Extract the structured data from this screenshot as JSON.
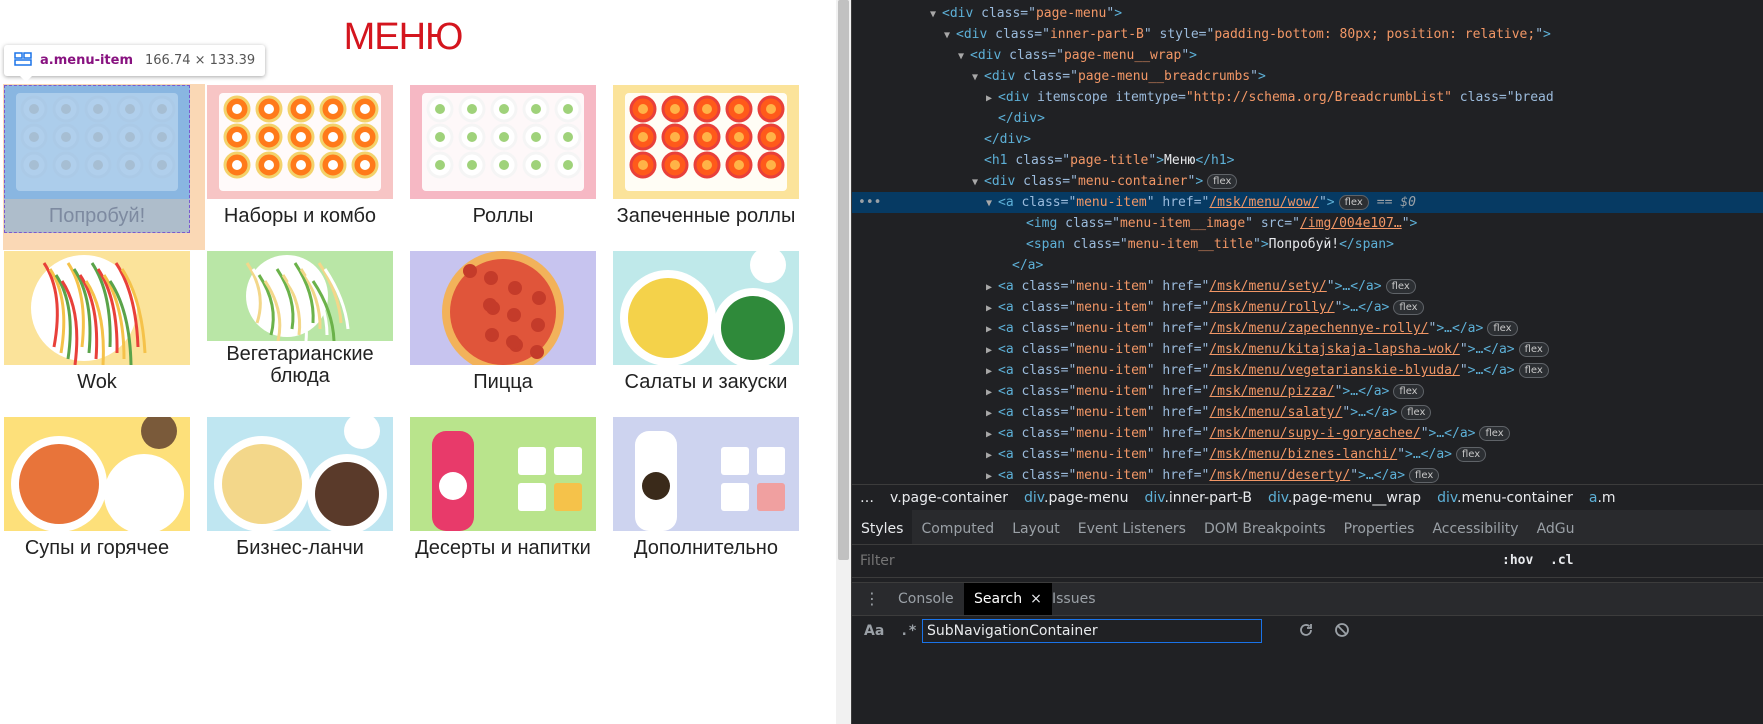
{
  "page": {
    "title": "МЕНЮ",
    "menu_items": [
      {
        "title": "Попробуй!",
        "bg": "#a9c8e6"
      },
      {
        "title": "Наборы и комбо",
        "bg": "#f7c5c5"
      },
      {
        "title": "Роллы",
        "bg": "#f6b8c4"
      },
      {
        "title": "Запеченные роллы",
        "bg": "#fbe39a"
      },
      {
        "title": "Wok",
        "bg": "#fbe39a"
      },
      {
        "title": "Вегетарианские блюда",
        "bg": "#b9e6a6"
      },
      {
        "title": "Пицца",
        "bg": "#c7c4ef"
      },
      {
        "title": "Салаты и закуски",
        "bg": "#bfe9ea"
      },
      {
        "title": "Супы и горячее",
        "bg": "#fde07a"
      },
      {
        "title": "Бизнес-ланчи",
        "bg": "#bfe6f1"
      },
      {
        "title": "Десерты и напитки",
        "bg": "#b9e48c"
      },
      {
        "title": "Дополнительно",
        "bg": "#cdd3ef"
      }
    ]
  },
  "tooltip": {
    "tag": "a.menu-item",
    "dims": "166.74 × 133.39"
  },
  "devtools": {
    "dom": [
      {
        "indent": 78,
        "tri": "▼",
        "open": "<div",
        "attrs": [
          [
            "class",
            "page-menu"
          ]
        ],
        "close": ">"
      },
      {
        "indent": 92,
        "tri": "▼",
        "open": "<div",
        "attrs": [
          [
            "class",
            "inner-part-B"
          ],
          [
            "style",
            "padding-bottom: 80px; position: relative;"
          ]
        ],
        "close": ">"
      },
      {
        "indent": 106,
        "tri": "▼",
        "open": "<div",
        "attrs": [
          [
            "class",
            "page-menu__wrap"
          ]
        ],
        "close": ">"
      },
      {
        "indent": 120,
        "tri": "▼",
        "open": "<div",
        "attrs": [
          [
            "class",
            "page-menu__breadcrumbs"
          ]
        ],
        "close": ">"
      },
      {
        "indent": 134,
        "tri": "▶",
        "open": "<div",
        "attrs_raw": " itemscope itemtype=",
        "raw_val": "\"http://schema.org/BreadcrumbList\"",
        "tail": " class=\"bread"
      },
      {
        "indent": 134,
        "tri": "",
        "plain": "</div>"
      },
      {
        "indent": 120,
        "tri": "",
        "plain": "</div>"
      },
      {
        "indent": 120,
        "tri": "",
        "open": "<h1",
        "attrs": [
          [
            "class",
            "page-title"
          ]
        ],
        "close": ">",
        "text": "Меню",
        "end": "</h1>"
      },
      {
        "indent": 120,
        "tri": "▼",
        "open": "<div",
        "attrs": [
          [
            "class",
            "menu-container"
          ]
        ],
        "close": ">",
        "badge": "flex"
      },
      {
        "indent": 134,
        "tri": "▼",
        "open": "<a",
        "attrs": [
          [
            "class",
            "menu-item"
          ]
        ],
        "href": "/msk/menu/wow/",
        "close": ">",
        "badge": "flex",
        "eq": "== $0",
        "selected": true
      },
      {
        "indent": 162,
        "tri": "",
        "open": "<img",
        "attrs": [
          [
            "class",
            "menu-item__image"
          ]
        ],
        "src": "/img/004e107…",
        "close": ">"
      },
      {
        "indent": 162,
        "tri": "",
        "open": "<span",
        "attrs": [
          [
            "class",
            "menu-item__title"
          ]
        ],
        "close": ">",
        "text": "Попробуй!",
        "end": "</span>"
      },
      {
        "indent": 148,
        "tri": "",
        "plain": "</a>"
      },
      {
        "indent": 134,
        "tri": "▶",
        "open": "<a",
        "attrs": [
          [
            "class",
            "menu-item"
          ]
        ],
        "href": "/msk/menu/sety/",
        "close": ">…</a>",
        "badge": "flex"
      },
      {
        "indent": 134,
        "tri": "▶",
        "open": "<a",
        "attrs": [
          [
            "class",
            "menu-item"
          ]
        ],
        "href": "/msk/menu/rolly/",
        "close": ">…</a>",
        "badge": "flex"
      },
      {
        "indent": 134,
        "tri": "▶",
        "open": "<a",
        "attrs": [
          [
            "class",
            "menu-item"
          ]
        ],
        "href": "/msk/menu/zapechennye-rolly/",
        "close": ">…</a>",
        "badge": "flex"
      },
      {
        "indent": 134,
        "tri": "▶",
        "open": "<a",
        "attrs": [
          [
            "class",
            "menu-item"
          ]
        ],
        "href": "/msk/menu/kitajskaja-lapsha-wok/",
        "close": ">…</a>",
        "badge": "flex"
      },
      {
        "indent": 134,
        "tri": "▶",
        "open": "<a",
        "attrs": [
          [
            "class",
            "menu-item"
          ]
        ],
        "href": "/msk/menu/vegetarianskie-blyuda/",
        "close": ">…</a>",
        "badge": "flex"
      },
      {
        "indent": 134,
        "tri": "▶",
        "open": "<a",
        "attrs": [
          [
            "class",
            "menu-item"
          ]
        ],
        "href": "/msk/menu/pizza/",
        "close": ">…</a>",
        "badge": "flex"
      },
      {
        "indent": 134,
        "tri": "▶",
        "open": "<a",
        "attrs": [
          [
            "class",
            "menu-item"
          ]
        ],
        "href": "/msk/menu/salaty/",
        "close": ">…</a>",
        "badge": "flex"
      },
      {
        "indent": 134,
        "tri": "▶",
        "open": "<a",
        "attrs": [
          [
            "class",
            "menu-item"
          ]
        ],
        "href": "/msk/menu/supy-i-goryachee/",
        "close": ">…</a>",
        "badge": "flex"
      },
      {
        "indent": 134,
        "tri": "▶",
        "open": "<a",
        "attrs": [
          [
            "class",
            "menu-item"
          ]
        ],
        "href": "/msk/menu/biznes-lanchi/",
        "close": ">…</a>",
        "badge": "flex"
      },
      {
        "indent": 134,
        "tri": "▶",
        "open": "<a",
        "attrs": [
          [
            "class",
            "menu-item"
          ]
        ],
        "href": "/msk/menu/deserty/",
        "close": ">…</a>",
        "badge": "flex"
      }
    ],
    "breadcrumbs": [
      {
        "k": "",
        "c": "…"
      },
      {
        "k": "",
        "c": "v.page-container"
      },
      {
        "k": "div",
        "c": ".page-menu"
      },
      {
        "k": "div",
        "c": ".inner-part-B"
      },
      {
        "k": "div",
        "c": ".page-menu__wrap"
      },
      {
        "k": "div",
        "c": ".menu-container"
      },
      {
        "k": "a",
        "c": ".m"
      }
    ],
    "panel_tabs": [
      "Styles",
      "Computed",
      "Layout",
      "Event Listeners",
      "DOM Breakpoints",
      "Properties",
      "Accessibility",
      "AdGu"
    ],
    "active_panel_tab": "Styles",
    "filter_placeholder": "Filter",
    "hov_label": ":hov",
    "cls_label": ".cl",
    "drawer_tabs": [
      "Console",
      "Search",
      "Issues"
    ],
    "active_drawer_tab": "Search",
    "search_case_label": "Aa",
    "search_regex_label": ".*",
    "search_value": "SubNavigationContainer"
  }
}
